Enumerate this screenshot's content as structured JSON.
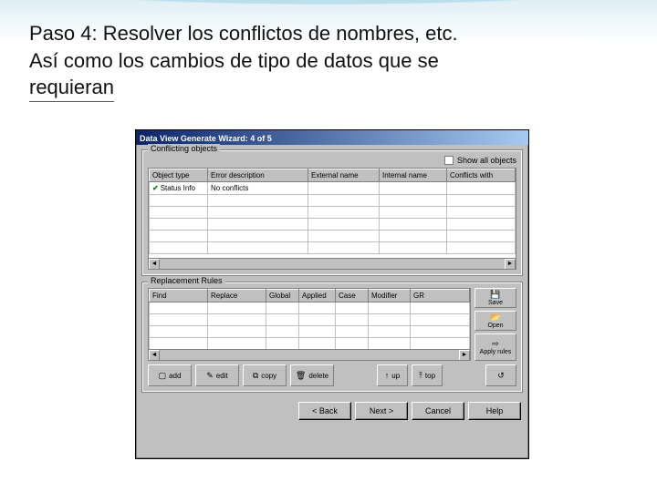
{
  "slide": {
    "heading_line1": "Paso 4: Resolver los conflictos de nombres, etc.",
    "heading_line2": "Así como los cambios de tipo de datos que se",
    "heading_line3": "requieran"
  },
  "dialog": {
    "title": "Data View Generate Wizard: 4 of 5",
    "group1": {
      "label": "Conflicting objects",
      "show_all_label": "Show all objects",
      "columns": [
        "Object type",
        "Error description",
        "External name",
        "Internal name",
        "Conflicts with"
      ],
      "rows": [
        {
          "type": "Status Info",
          "desc": "No conflicts",
          "ext": "",
          "int": "",
          "conf": "",
          "check": true
        }
      ]
    },
    "group2": {
      "label": "Replacement Rules",
      "columns": [
        "Find",
        "Replace",
        "Global",
        "Applied",
        "Case",
        "Modifier",
        "GR"
      ],
      "buttons": {
        "save": "Save",
        "open": "Open",
        "apply": "Apply rules"
      }
    },
    "tools": {
      "add": "add",
      "edit": "edit",
      "copy": "copy",
      "delete": "delete",
      "up": "up",
      "top": "top",
      "reset": ""
    },
    "wizard": {
      "back": "< Back",
      "next": "Next >",
      "cancel": "Cancel",
      "help": "Help"
    }
  }
}
